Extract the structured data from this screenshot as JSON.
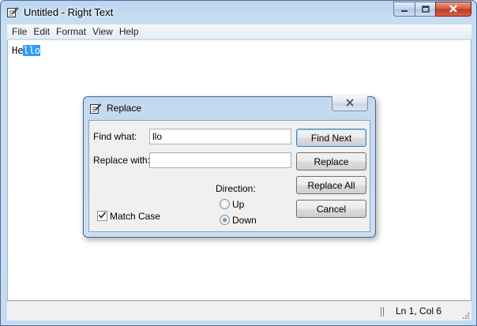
{
  "window": {
    "title": "Untitled - Right Text",
    "icon": "notepad-pencil-icon",
    "controls": [
      "minimize-icon",
      "maximize-icon",
      "close-icon"
    ]
  },
  "menu": {
    "items": [
      "File",
      "Edit",
      "Format",
      "View",
      "Help"
    ]
  },
  "editor": {
    "text_unselected": "He",
    "text_selected": "llo"
  },
  "status": {
    "position": "Ln 1, Col 6"
  },
  "replace_dialog": {
    "title": "Replace",
    "icon": "notepad-pencil-icon",
    "find_label": "Find what:",
    "find_value": "llo",
    "replace_label": "Replace with:",
    "replace_value": "",
    "direction_label": "Direction:",
    "direction_options": [
      "Up",
      "Down"
    ],
    "direction_selected": "Down",
    "match_case_label": "Match Case",
    "match_case_checked": true,
    "buttons": [
      "Find Next",
      "Replace",
      "Replace All",
      "Cancel"
    ]
  },
  "colors": {
    "selection": "#3399ff",
    "close_button": "#c7432a",
    "frame": "#c6dbf1"
  }
}
